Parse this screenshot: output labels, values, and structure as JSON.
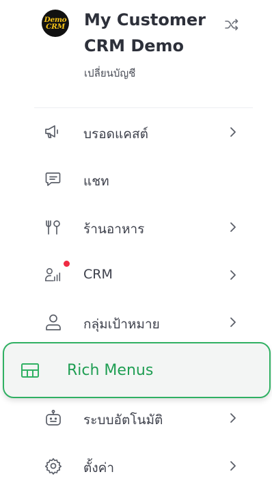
{
  "account": {
    "logo_lines": [
      "Demo",
      "CRM"
    ],
    "name": "My Customer CRM Demo",
    "switch_label": "เปลี่ยนบัญชี"
  },
  "menu": {
    "items": [
      {
        "label": "บรอดแคสต์",
        "icon": "megaphone-icon",
        "has_chevron": true
      },
      {
        "label": "แชท",
        "icon": "chat-icon",
        "has_chevron": false
      },
      {
        "label": "ร้านอาหาร",
        "icon": "utensils-icon",
        "has_chevron": true
      },
      {
        "label": "CRM",
        "icon": "crm-chart-icon",
        "has_chevron": true,
        "notification_dot": true
      },
      {
        "label": "กลุ่มเป้าหมาย",
        "icon": "user-icon",
        "has_chevron": true
      },
      {
        "label": "Rich Menus",
        "icon": "rich-menu-icon",
        "has_chevron": false,
        "active": true
      },
      {
        "label": "ระบบอัตโนมัติ",
        "icon": "robot-icon",
        "has_chevron": true
      },
      {
        "label": "ตั้งค่า",
        "icon": "gear-icon",
        "has_chevron": true
      }
    ]
  },
  "colors": {
    "accent": "#2fb062",
    "text": "#3c3f4a",
    "notification": "#ef2b43",
    "logo_text": "#f5c318"
  }
}
